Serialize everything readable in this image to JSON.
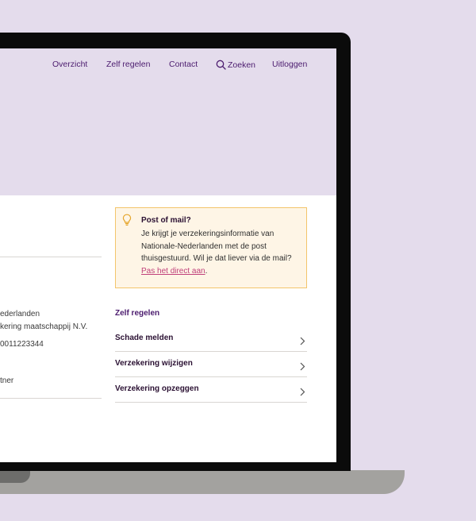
{
  "nav": {
    "overzicht": "Overzicht",
    "zelf_regelen": "Zelf regelen",
    "contact": "Contact",
    "zoeken": "Zoeken",
    "uitloggen": "Uitloggen"
  },
  "details": {
    "line1": "ederlanden",
    "line2": "kering maatschappij N.V.",
    "line3": "0011223344",
    "line4": "tner"
  },
  "notice": {
    "title": "Post of mail?",
    "body_text": "Je krijgt je verzekeringsinformatie van Nationale-Nederlanden met de post thuisgestuurd. Wil je dat liever via de mail? ",
    "link_text": "Pas het direct aan",
    "after_link": "."
  },
  "zelf_regelen": {
    "heading": "Zelf regelen",
    "actions": [
      {
        "label": "Schade melden"
      },
      {
        "label": "Verzekering wijzigen"
      },
      {
        "label": "Verzekering opzeggen"
      }
    ]
  },
  "colors": {
    "brand_purple": "#4b1b6e",
    "hero_bg": "#e4dcec",
    "notice_bg": "#fef5e6",
    "notice_border": "#f3c56b",
    "link_pink": "#c0407a"
  },
  "icons": {
    "search": "search-icon",
    "bulb": "lightbulb-icon",
    "chevron": "chevron-right-icon"
  }
}
